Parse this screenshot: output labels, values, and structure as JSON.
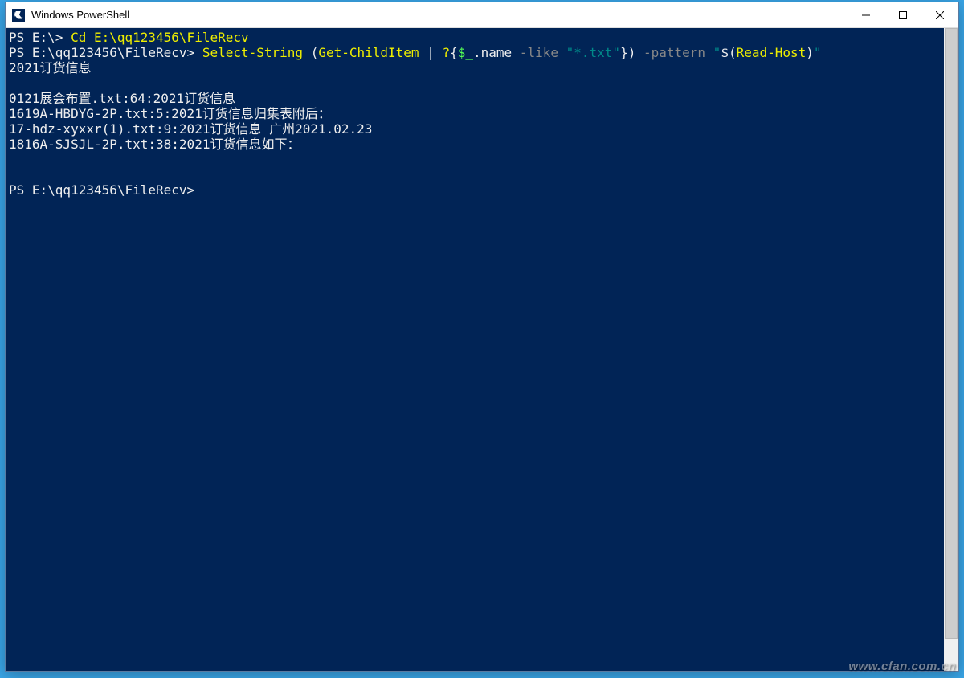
{
  "window": {
    "title": "Windows PowerShell"
  },
  "terminal": {
    "line1_prompt": "PS E:\\> ",
    "line1_cmd": "Cd E:\\qq123456\\FileRecv",
    "line2_prompt": "PS E:\\qq123456\\FileRecv> ",
    "line2_cmd_a": "Select-String",
    "line2_paren_open": " (",
    "line2_cmd_b": "Get-ChildItem",
    "line2_pipe": " | ",
    "line2_q": "?",
    "line2_brace_open": "{",
    "line2_var": "$_",
    "line2_dot_name": ".name ",
    "line2_like": "-like",
    "line2_space": " ",
    "line2_pattern_str": "\"*.txt\"",
    "line2_brace_close": "}",
    "line2_paren_close": ") ",
    "line2_pattern_flag": "-pattern",
    "line2_space2": " ",
    "line2_quote_open": "\"",
    "line2_subexpr": "$(",
    "line2_readhost": "Read-Host",
    "line2_subexpr_close": ")",
    "line2_quote_close": "\"",
    "line3": "2021订货信息",
    "blank": "",
    "result1": "0121展会布置.txt:64:2021订货信息",
    "result2": "1619A-HBDYG-2P.txt:5:2021订货信息归集表附后：",
    "result3": "17-hdz-xyxxr(1).txt:9:2021订货信息 广州2021.02.23",
    "result4": "1816A-SJSJL-2P.txt:38:2021订货信息如下：",
    "final_prompt": "PS E:\\qq123456\\FileRecv> "
  },
  "watermark": "www.cfan.com.cn"
}
